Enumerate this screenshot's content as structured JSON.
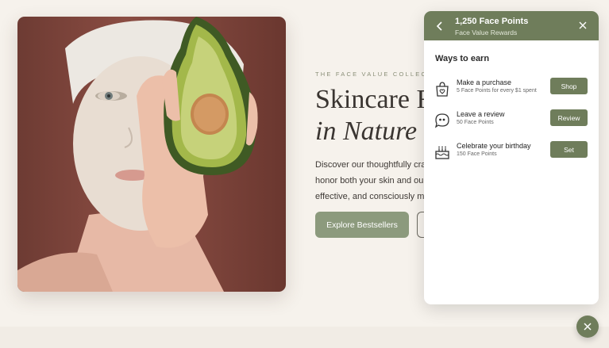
{
  "hero": {
    "eyebrow": "THE FACE VALUE COLLECTION",
    "title_line1": "Skincare F",
    "title_line2": "in Nature",
    "body_line1": "Discover our thoughtfully craf",
    "body_line2": "honor both your skin and our p",
    "body_line3": "effective, and consciously mad",
    "explore_label": "Explore Bestsellers"
  },
  "rewards": {
    "points_title": "1,250 Face Points",
    "program_name": "Face Value Rewards",
    "ways_title": "Ways to earn",
    "items": [
      {
        "label": "Make a purchase",
        "desc": "5 Face Points for every $1 spent",
        "button": "Shop",
        "icon": "shopping-bag-heart-icon"
      },
      {
        "label": "Leave a review",
        "desc": "50 Face Points",
        "button": "Review",
        "icon": "speech-bubble-quote-icon"
      },
      {
        "label": "Celebrate your birthday",
        "desc": "150 Face Points",
        "button": "Set",
        "icon": "birthday-cake-icon"
      }
    ]
  },
  "colors": {
    "accent": "#6f7d5b",
    "explore_button": "#8c9a7d",
    "background": "#f6f2ec"
  }
}
